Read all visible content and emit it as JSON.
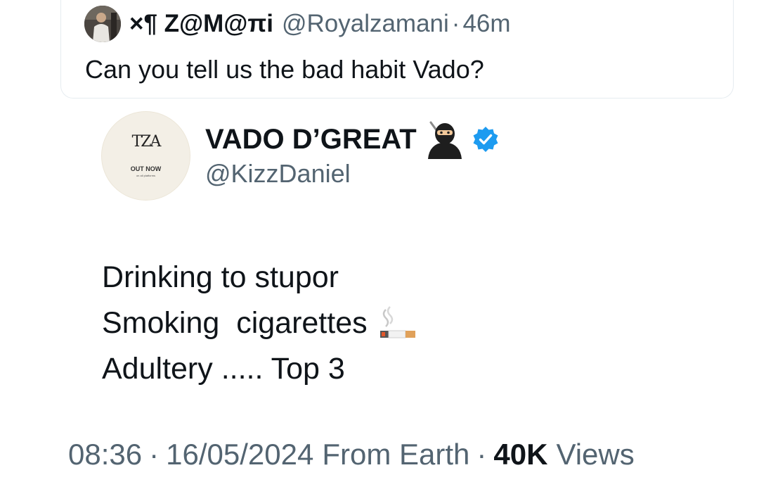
{
  "quote": {
    "display_name": "×¶ Z@M@πi",
    "handle": "@Royalzamani",
    "separator": "·",
    "time": "46m",
    "text": "Can you tell us the bad habit Vado?",
    "avatar_icon": "user-avatar-photo"
  },
  "tweet": {
    "display_name": "VADO D’GREAT",
    "name_emoji": "ninja",
    "verified_icon": "verified-badge-icon",
    "verified_color": "#1d9bf0",
    "handle": "@KizzDaniel",
    "avatar": {
      "logo_text": "TZA",
      "out_now_text": "OUT NOW",
      "sub_text": "on all platforms"
    },
    "lines": [
      "Drinking to stupor",
      "Smoking  cigarettes",
      "Adultery ..... Top 3"
    ],
    "line_2_emoji": "cigarette",
    "meta": {
      "time": "08:36",
      "separator": "·",
      "date": "16/05/2024",
      "source": "From Earth",
      "views_count": "40K",
      "views_label": "Views"
    }
  },
  "colors": {
    "text_primary": "#0f1419",
    "text_secondary": "#536471",
    "border": "#e6ecf0"
  }
}
